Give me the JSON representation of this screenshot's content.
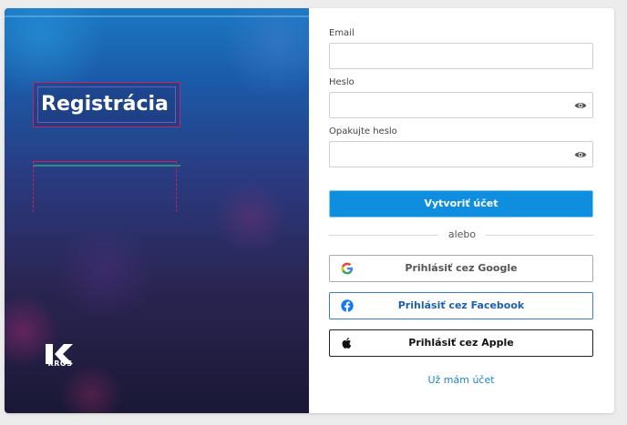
{
  "hero": {
    "title": "Registrácia",
    "logo_text": "KROS"
  },
  "form": {
    "email_label": "Email",
    "email_value": "",
    "password_label": "Heslo",
    "password_value": "",
    "repeat_password_label": "Opakujte heslo",
    "repeat_password_value": "",
    "create_account_label": "Vytvoriť účet",
    "divider_text": "alebo",
    "google_label": "Prihlásiť cez Google",
    "facebook_label": "Prihlásiť cez Facebook",
    "apple_label": "Prihlásiť cez Apple",
    "have_account_link": "Už mám účet"
  },
  "icons": {
    "password_toggle": "eye-icon",
    "repeat_password_toggle": "eye-icon",
    "google": "google-icon",
    "facebook": "facebook-icon",
    "apple": "apple-icon"
  },
  "colors": {
    "primary": "#0f8ee0",
    "link": "#1a85cf",
    "facebook": "#1877f2",
    "hero_top": "#1b78c2",
    "hero_bottom": "#1a1836"
  }
}
